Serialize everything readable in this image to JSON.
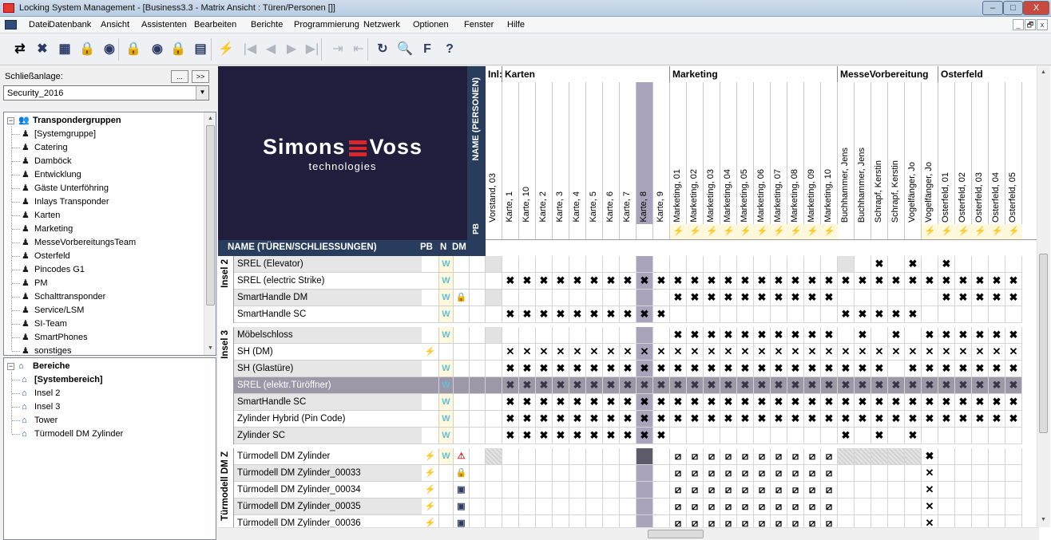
{
  "window": {
    "title": "Locking System Management - [Business3.3 - Matrix Ansicht : Türen/Personen []]",
    "controls": {
      "minimize": "–",
      "maximize": "□",
      "close": "X"
    }
  },
  "menu": {
    "items": [
      "Datei",
      "Datenbank",
      "Ansicht",
      "Assistenten",
      "Bearbeiten",
      "Berichte",
      "Programmierung",
      "Netzwerk",
      "Optionen",
      "Fenster",
      "Hilfe"
    ],
    "mdi_controls": [
      "_",
      "🗗",
      "x"
    ]
  },
  "toolbar": {
    "buttons": [
      {
        "icon": "transfer-icon",
        "glyph": "⇄",
        "enabled": true
      },
      {
        "icon": "delete-icon",
        "glyph": "✖",
        "enabled": true,
        "color": "#2b3b66"
      },
      {
        "icon": "new-transponder-icon",
        "glyph": "▦",
        "enabled": true,
        "color": "#2b3b66"
      },
      {
        "icon": "new-lock-icon",
        "glyph": "🔒",
        "enabled": true,
        "color": "#2b3b66"
      },
      {
        "icon": "new-area-icon",
        "glyph": "◉",
        "enabled": true,
        "color": "#2b3b66"
      },
      {
        "icon": "lock-properties-icon",
        "glyph": "🔒",
        "enabled": true,
        "color": "#2b3b66"
      },
      {
        "icon": "transponder-properties-icon",
        "glyph": "◉",
        "enabled": true,
        "color": "#2b3b66"
      },
      {
        "icon": "lock-query-icon",
        "glyph": "🔒",
        "enabled": true,
        "color": "#2b3b66"
      },
      {
        "icon": "report-icon",
        "glyph": "▤",
        "enabled": true,
        "color": "#2b3b66"
      },
      {
        "icon": "program-icon",
        "glyph": "⚡",
        "enabled": false
      },
      {
        "icon": "first-icon",
        "glyph": "|◀",
        "enabled": false
      },
      {
        "icon": "prev-icon",
        "glyph": "◀",
        "enabled": false
      },
      {
        "icon": "next-icon",
        "glyph": "▶",
        "enabled": false
      },
      {
        "icon": "last-icon",
        "glyph": "▶|",
        "enabled": false
      },
      {
        "icon": "collapse-icon",
        "glyph": "⇥",
        "enabled": false
      },
      {
        "icon": "expand-icon",
        "glyph": "⇤",
        "enabled": false
      },
      {
        "icon": "refresh-icon",
        "glyph": "↻",
        "enabled": true,
        "color": "#2b3b66"
      },
      {
        "icon": "search-icon",
        "glyph": "🔍",
        "enabled": true,
        "color": "#2b3b66"
      },
      {
        "icon": "filter-icon",
        "glyph": "F",
        "enabled": true,
        "color": "#2b3b66"
      },
      {
        "icon": "help-icon",
        "glyph": "?",
        "enabled": true,
        "color": "#2b3b66"
      }
    ]
  },
  "left_panel": {
    "label": "Schließanlage:",
    "btn_browse": "...",
    "btn_expand": ">>",
    "combo_value": "Security_2016",
    "transponder_tree": {
      "root": "Transpondergruppen",
      "items": [
        "[Systemgruppe]",
        "Catering",
        "Damböck",
        "Entwicklung",
        "Gäste Unterföhring",
        "Inlays Transponder",
        "Karten",
        "Marketing",
        "MesseVorbereitungsTeam",
        "Osterfeld",
        "Pincodes G1",
        "PM",
        "Schalttransponder",
        "Service/LSM",
        "SI-Team",
        "SmartPhones",
        "sonstiges"
      ]
    },
    "area_tree": {
      "root": "Bereiche",
      "items": [
        "[Systembereich]",
        "Insel 2",
        "Insel 3",
        "Tower",
        "Türmodell DM Zylinder"
      ]
    }
  },
  "matrix": {
    "logo": {
      "brand_left": "Simons",
      "brand_right": "Voss",
      "sub": "technologies"
    },
    "persons_header": "NAME (PERSONEN)",
    "pb_label": "PB",
    "row_header": {
      "name": "NAME (TÜREN/SCHLIESSUNGEN)",
      "pb": "PB",
      "n": "N",
      "dm": "DM"
    },
    "groups": [
      {
        "label": "Inl:",
        "col": 0
      },
      {
        "label": "Karten",
        "col": 1
      },
      {
        "label": "Marketing",
        "col": 11
      },
      {
        "label": "MesseVorbereitung",
        "col": 21
      },
      {
        "label": "Osterfeld",
        "col": 27
      }
    ],
    "columns": [
      "Vorstand, 03",
      "Karte, 1",
      "Karte, 10",
      "Karte, 2",
      "Karte, 3",
      "Karte, 4",
      "Karte, 5",
      "Karte, 6",
      "Karte, 7",
      "Karte, 8",
      "Karte, 9",
      "Marketing, 01",
      "Marketing, 02",
      "Marketing, 03",
      "Marketing, 04",
      "Marketing, 05",
      "Marketing, 06",
      "Marketing, 07",
      "Marketing, 08",
      "Marketing, 09",
      "Marketing, 10",
      "Buchhammer, Jens",
      "Buchhammer, Jens",
      "Schrapf, Kerstin",
      "Schrapf, Kerstin",
      "Vogelfänger, Jo",
      "Vogelfänger, Jo",
      "Osterfeld, 01",
      "Osterfeld, 02",
      "Osterfeld, 03",
      "Osterfeld, 04",
      "Osterfeld, 05"
    ],
    "pb_lightning": "⚡",
    "row_groups": [
      {
        "label": "Insel 2",
        "rows": 4
      },
      {
        "label": "Insel 3",
        "rows": 7
      },
      {
        "label": "Türmodell DM Z",
        "rows": 5
      }
    ],
    "rows": [
      {
        "name": "SREL (Elevator)",
        "pb": "",
        "n": "W",
        "dm": "",
        "cells": "g....................g.#.#.#....."
      },
      {
        "name": "SREL (electric Strike)",
        "pb": "",
        "n": "W",
        "dm": "",
        "cells": ".XXXXXXXXXXXXXXXXXXXXXXXXXXXXXXX"
      },
      {
        "name": "SmartHandle DM",
        "pb": "",
        "n": "W",
        "dm": "🔒",
        "cells": "g..........XXXXXXXXXX......XXXXX"
      },
      {
        "name": "SmartHandle SC",
        "pb": "",
        "n": "W",
        "dm": "",
        "cells": ".XXXXXXXXXX..........XXXXX......"
      },
      {
        "name": "Möbelschloss",
        "pb": "",
        "n": "W",
        "dm": "",
        "cells": "g..........XXXXXXXXXX.X.X.XXXXXX"
      },
      {
        "name": "SH (DM)",
        "pb": "⚡",
        "n": "",
        "dm": "",
        "cells": ".xxxxxxxxxxxxxxxxxxxxxxxxxxxxxxx"
      },
      {
        "name": "SH (Glastüre)",
        "pb": "",
        "n": "W",
        "dm": "",
        "cells": ".XXXXXXXXXXXXXXXXXXXXXXX.XXXXXXX"
      },
      {
        "name": "SREL (elektr.Türöffner)",
        "pb": "",
        "n": "W",
        "dm": "",
        "cells": "sXXXXXXXXXXXXXXXXXXXXXXXXXXXXXXX",
        "selected": true
      },
      {
        "name": "SmartHandle SC",
        "pb": "",
        "n": "W",
        "dm": "",
        "cells": ".XXXXXXXXXXXXXXXXXXXXXXXXXXXXXXX"
      },
      {
        "name": "Zylinder Hybrid (Pin Code)",
        "pb": "",
        "n": "W",
        "dm": "",
        "cells": ".XXXXXXXXXXXXXXXXXXXXXXXXXXXXXXX"
      },
      {
        "name": "Zylinder SC",
        "pb": "",
        "n": "W",
        "dm": "",
        "cells": ".XXXXXXXXXX..........X.X.X......"
      },
      {
        "name": "Türmodell DM Zylinder",
        "pb": "⚡",
        "n": "W",
        "dm": "⚠",
        "cells": "h..........ZZZZZZZZZZhhhhhX....."
      },
      {
        "name": "Türmodell DM Zylinder_00033",
        "pb": "⚡",
        "n": "",
        "dm": "🔒",
        "cells": "...........ZZZZZZZZZZ.....x....."
      },
      {
        "name": "Türmodell DM Zylinder_00034",
        "pb": "⚡",
        "n": "",
        "dm": "▣",
        "cells": "...........ZZZZZZZZZZ.....x....."
      },
      {
        "name": "Türmodell DM Zylinder_00035",
        "pb": "⚡",
        "n": "",
        "dm": "▣",
        "cells": "...........ZZZZZZZZZZ.....x....."
      },
      {
        "name": "Türmodell DM Zylinder_00036",
        "pb": "⚡",
        "n": "",
        "dm": "▣",
        "cells": "...........ZZZZZZZZZZ.....x....."
      }
    ],
    "selected_column": 9
  },
  "colors": {
    "header_navy": "#283d5e",
    "logo_bg": "#211d3d",
    "selection": "#9c98a8",
    "n_w": "#56c3e8",
    "warning": "#e02020"
  }
}
